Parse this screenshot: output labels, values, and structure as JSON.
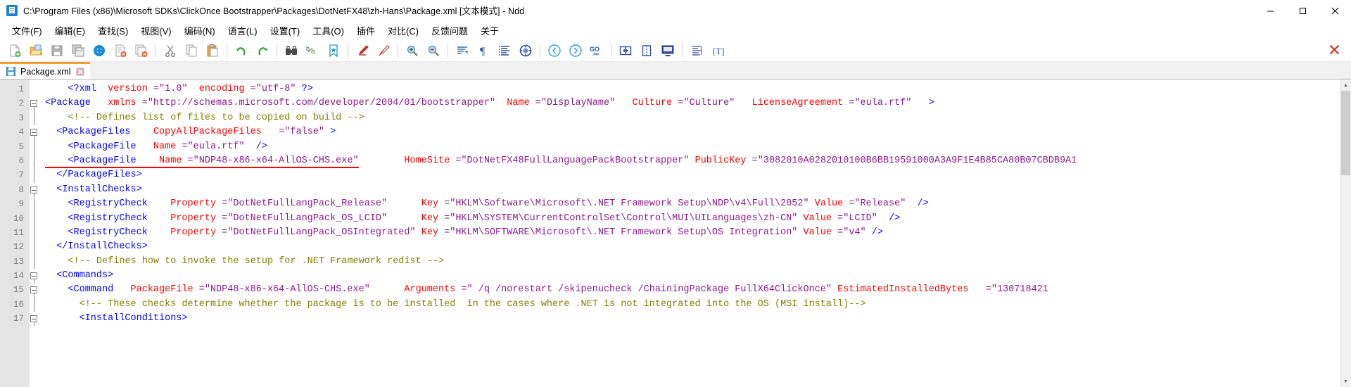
{
  "window": {
    "title": "C:\\Program Files (x86)\\Microsoft SDKs\\ClickOnce Bootstrapper\\Packages\\DotNetFX48\\zh-Hans\\Package.xml [文本模式] - Ndd",
    "app_icon": "notepadpp-icon",
    "minimize_label": "—",
    "maximize_label": "▢",
    "close_label": "✕"
  },
  "menu": {
    "items": [
      {
        "label": "文件(F)",
        "name": "menu-file"
      },
      {
        "label": "编辑(E)",
        "name": "menu-edit"
      },
      {
        "label": "查找(S)",
        "name": "menu-search"
      },
      {
        "label": "视图(V)",
        "name": "menu-view"
      },
      {
        "label": "编码(N)",
        "name": "menu-encoding"
      },
      {
        "label": "语言(L)",
        "name": "menu-language"
      },
      {
        "label": "设置(T)",
        "name": "menu-settings"
      },
      {
        "label": "工具(O)",
        "name": "menu-tools"
      },
      {
        "label": "插件",
        "name": "menu-plugins"
      },
      {
        "label": "对比(C)",
        "name": "menu-compare"
      },
      {
        "label": "反馈问题",
        "name": "menu-feedback"
      },
      {
        "label": "关于",
        "name": "menu-about"
      }
    ]
  },
  "toolbar": {
    "close_all_label": "✕",
    "buttons": [
      {
        "icon": "new-file-icon",
        "group": 0
      },
      {
        "icon": "open-folder-icon",
        "group": 0
      },
      {
        "icon": "save-icon",
        "group": 0
      },
      {
        "icon": "save-all-icon",
        "group": 0
      },
      {
        "icon": "print-icon",
        "group": 0
      },
      {
        "icon": "close-file-icon",
        "group": 0
      },
      {
        "icon": "close-all-files-icon",
        "group": 0
      },
      {
        "icon": "cut-icon",
        "group": 1
      },
      {
        "icon": "copy-icon",
        "group": 1
      },
      {
        "icon": "paste-icon",
        "group": 1
      },
      {
        "icon": "undo-icon",
        "group": 2
      },
      {
        "icon": "redo-icon",
        "group": 2
      },
      {
        "icon": "find-icon",
        "group": 3
      },
      {
        "icon": "replace-icon",
        "group": 3
      },
      {
        "icon": "bookmark-icon",
        "group": 3
      },
      {
        "icon": "marker-icon",
        "group": 4
      },
      {
        "icon": "clear-marker-icon",
        "group": 4
      },
      {
        "icon": "zoom-in-icon",
        "group": 5
      },
      {
        "icon": "zoom-out-icon",
        "group": 5
      },
      {
        "icon": "word-wrap-icon",
        "group": 6
      },
      {
        "icon": "show-pilcrow-icon",
        "group": 6
      },
      {
        "icon": "indent-guide-icon",
        "group": 6
      },
      {
        "icon": "ui-theme-icon",
        "group": 6
      },
      {
        "icon": "previous-icon",
        "group": 7
      },
      {
        "icon": "next-icon",
        "group": 7
      },
      {
        "icon": "go-icon",
        "group": 7
      },
      {
        "icon": "split-horizontal-icon",
        "group": 8
      },
      {
        "icon": "split-vertical-icon",
        "group": 8
      },
      {
        "icon": "monitor-icon",
        "group": 8
      },
      {
        "icon": "function-list-icon",
        "group": 9
      },
      {
        "icon": "text-direction-icon",
        "group": 9
      }
    ]
  },
  "tabs": [
    {
      "label": "Package.xml",
      "icon": "saved-file-icon",
      "close_icon": "close-tab-icon",
      "active": true
    }
  ],
  "editor": {
    "line_numbers": [
      1,
      2,
      3,
      4,
      5,
      6,
      7,
      8,
      9,
      10,
      11,
      12,
      13,
      14,
      15,
      16,
      17
    ],
    "lines": [
      {
        "num": 1,
        "fold": "none",
        "tokens": [
          {
            "t": "    ",
            "c": "txt"
          },
          {
            "t": "<?",
            "c": "punct"
          },
          {
            "t": "xml",
            "c": "pi"
          },
          {
            "t": "  ",
            "c": "txt"
          },
          {
            "t": "version ",
            "c": "attr"
          },
          {
            "t": "=\"1.0\"",
            "c": "val"
          },
          {
            "t": "  ",
            "c": "txt"
          },
          {
            "t": "encoding ",
            "c": "attr"
          },
          {
            "t": "=\"utf-8\"",
            "c": "val"
          },
          {
            "t": " ",
            "c": "txt"
          },
          {
            "t": "?>",
            "c": "punct"
          }
        ]
      },
      {
        "num": 2,
        "fold": "open-start",
        "tokens": [
          {
            "t": "<Package",
            "c": "tag"
          },
          {
            "t": "   ",
            "c": "txt"
          },
          {
            "t": "xmlns ",
            "c": "attr"
          },
          {
            "t": "=\"http://schemas.microsoft.com/developer/2004/01/bootstrapper\"",
            "c": "val"
          },
          {
            "t": "  ",
            "c": "txt"
          },
          {
            "t": "Name ",
            "c": "attr"
          },
          {
            "t": "=\"DisplayName\"",
            "c": "val"
          },
          {
            "t": "   ",
            "c": "txt"
          },
          {
            "t": "Culture ",
            "c": "attr"
          },
          {
            "t": "=\"Culture\"",
            "c": "val"
          },
          {
            "t": "   ",
            "c": "txt"
          },
          {
            "t": "LicenseAgreement ",
            "c": "attr"
          },
          {
            "t": "=\"eula.rtf\"",
            "c": "val"
          },
          {
            "t": "   ",
            "c": "txt"
          },
          {
            "t": ">",
            "c": "tag"
          }
        ]
      },
      {
        "num": 3,
        "fold": "line",
        "tokens": [
          {
            "t": "    <!-- Defines list of files to be copied on build -->",
            "c": "cmt"
          }
        ]
      },
      {
        "num": 4,
        "fold": "open-start",
        "tokens": [
          {
            "t": "  <PackageFiles",
            "c": "tag"
          },
          {
            "t": "    ",
            "c": "txt"
          },
          {
            "t": "CopyAllPackageFiles",
            "c": "attr"
          },
          {
            "t": "   ",
            "c": "txt"
          },
          {
            "t": "=\"false\"",
            "c": "val"
          },
          {
            "t": " ",
            "c": "txt"
          },
          {
            "t": ">",
            "c": "tag"
          }
        ]
      },
      {
        "num": 5,
        "fold": "line",
        "tokens": [
          {
            "t": "    <PackageFile",
            "c": "tag"
          },
          {
            "t": "   ",
            "c": "txt"
          },
          {
            "t": "Name ",
            "c": "attr"
          },
          {
            "t": "=\"eula.rtf\"",
            "c": "val"
          },
          {
            "t": "  ",
            "c": "txt"
          },
          {
            "t": "/>",
            "c": "tag"
          }
        ]
      },
      {
        "num": 6,
        "fold": "line",
        "error_underline": true,
        "tokens": [
          {
            "t": "    <PackageFile",
            "c": "tag",
            "err": true
          },
          {
            "t": "    ",
            "c": "txt",
            "err": true
          },
          {
            "t": "Name ",
            "c": "attr",
            "err": true
          },
          {
            "t": "=\"NDP48-x86-x64-AllOS-CHS.exe\"",
            "c": "val",
            "err": true
          },
          {
            "t": "        ",
            "c": "txt"
          },
          {
            "t": "HomeSite ",
            "c": "attr"
          },
          {
            "t": "=\"DotNetFX48FullLanguagePackBootstrapper\"",
            "c": "val"
          },
          {
            "t": " ",
            "c": "txt"
          },
          {
            "t": "PublicKey ",
            "c": "attr"
          },
          {
            "t": "=\"3082010A0282010100B6BB19591000A3A9F1E4B85CA80B07CBDB9A1",
            "c": "val"
          }
        ]
      },
      {
        "num": 7,
        "fold": "open-end",
        "tokens": [
          {
            "t": "  </PackageFiles>",
            "c": "tag"
          }
        ]
      },
      {
        "num": 8,
        "fold": "open-start",
        "tokens": [
          {
            "t": "  <InstallChecks>",
            "c": "tag"
          }
        ]
      },
      {
        "num": 9,
        "fold": "line",
        "tokens": [
          {
            "t": "    <RegistryCheck",
            "c": "tag"
          },
          {
            "t": "    ",
            "c": "txt"
          },
          {
            "t": "Property ",
            "c": "attr"
          },
          {
            "t": "=\"DotNetFullLangPack_Release\"",
            "c": "val"
          },
          {
            "t": "      ",
            "c": "txt"
          },
          {
            "t": "Key ",
            "c": "attr"
          },
          {
            "t": "=\"HKLM\\Software\\Microsoft\\.NET Framework Setup\\NDP\\v4\\Full\\2052\"",
            "c": "val"
          },
          {
            "t": " ",
            "c": "txt"
          },
          {
            "t": "Value ",
            "c": "attr"
          },
          {
            "t": "=\"Release\"",
            "c": "val"
          },
          {
            "t": "  ",
            "c": "txt"
          },
          {
            "t": "/>",
            "c": "tag"
          }
        ]
      },
      {
        "num": 10,
        "fold": "line",
        "tokens": [
          {
            "t": "    <RegistryCheck",
            "c": "tag"
          },
          {
            "t": "    ",
            "c": "txt"
          },
          {
            "t": "Property ",
            "c": "attr"
          },
          {
            "t": "=\"DotNetFullLangPack_OS_LCID\"",
            "c": "val"
          },
          {
            "t": "      ",
            "c": "txt"
          },
          {
            "t": "Key ",
            "c": "attr"
          },
          {
            "t": "=\"HKLM\\SYSTEM\\CurrentControlSet\\Control\\MUI\\UILanguages\\zh-CN\"",
            "c": "val"
          },
          {
            "t": " ",
            "c": "txt"
          },
          {
            "t": "Value ",
            "c": "attr"
          },
          {
            "t": "=\"LCID\"",
            "c": "val"
          },
          {
            "t": "  ",
            "c": "txt"
          },
          {
            "t": "/>",
            "c": "tag"
          }
        ]
      },
      {
        "num": 11,
        "fold": "line",
        "tokens": [
          {
            "t": "    <RegistryCheck",
            "c": "tag"
          },
          {
            "t": "    ",
            "c": "txt"
          },
          {
            "t": "Property ",
            "c": "attr"
          },
          {
            "t": "=\"DotNetFullLangPack_OSIntegrated\"",
            "c": "val"
          },
          {
            "t": " ",
            "c": "txt"
          },
          {
            "t": "Key ",
            "c": "attr"
          },
          {
            "t": "=\"HKLM\\SOFTWARE\\Microsoft\\.NET Framework Setup\\OS Integration\"",
            "c": "val"
          },
          {
            "t": " ",
            "c": "txt"
          },
          {
            "t": "Value ",
            "c": "attr"
          },
          {
            "t": "=\"v4\"",
            "c": "val"
          },
          {
            "t": " ",
            "c": "txt"
          },
          {
            "t": "/>",
            "c": "tag"
          }
        ]
      },
      {
        "num": 12,
        "fold": "open-end",
        "tokens": [
          {
            "t": "  </InstallChecks>",
            "c": "tag"
          }
        ]
      },
      {
        "num": 13,
        "fold": "line",
        "tokens": [
          {
            "t": "    <!-- Defines how to invoke the setup for .NET Framework redist -->",
            "c": "cmt"
          }
        ]
      },
      {
        "num": 14,
        "fold": "open-start",
        "tokens": [
          {
            "t": "  <Commands>",
            "c": "tag"
          }
        ]
      },
      {
        "num": 15,
        "fold": "open-start",
        "tokens": [
          {
            "t": "    <Command",
            "c": "tag"
          },
          {
            "t": "   ",
            "c": "txt"
          },
          {
            "t": "PackageFile ",
            "c": "attr"
          },
          {
            "t": "=\"NDP48-x86-x64-AllOS-CHS.exe\"",
            "c": "val"
          },
          {
            "t": "      ",
            "c": "txt"
          },
          {
            "t": "Arguments ",
            "c": "attr"
          },
          {
            "t": "=\" /q /norestart /skipenucheck /ChainingPackage FullX64ClickOnce\"",
            "c": "val"
          },
          {
            "t": " ",
            "c": "txt"
          },
          {
            "t": "EstimatedInstalledBytes ",
            "c": "attr"
          },
          {
            "t": "  =\"130718421",
            "c": "val"
          }
        ]
      },
      {
        "num": 16,
        "fold": "line",
        "tokens": [
          {
            "t": "      <!-- These checks determine whether the package is to be installed  in the cases where .NET is not integrated into the OS (MSI install)-->",
            "c": "cmt"
          }
        ]
      },
      {
        "num": 17,
        "fold": "open-start",
        "tokens": [
          {
            "t": "      <InstallConditions>",
            "c": "tag"
          }
        ]
      }
    ],
    "scrollbar": {
      "up_arrow": "▲",
      "down_arrow": "▼"
    }
  },
  "colors": {
    "tag": "#0000ff",
    "attribute": "#ff0000",
    "value": "#8b1a8b",
    "comment": "#808000",
    "error_underline": "#ff0000",
    "tab_accent": "#f0a030",
    "gutter_bg": "#e4e4e4"
  }
}
